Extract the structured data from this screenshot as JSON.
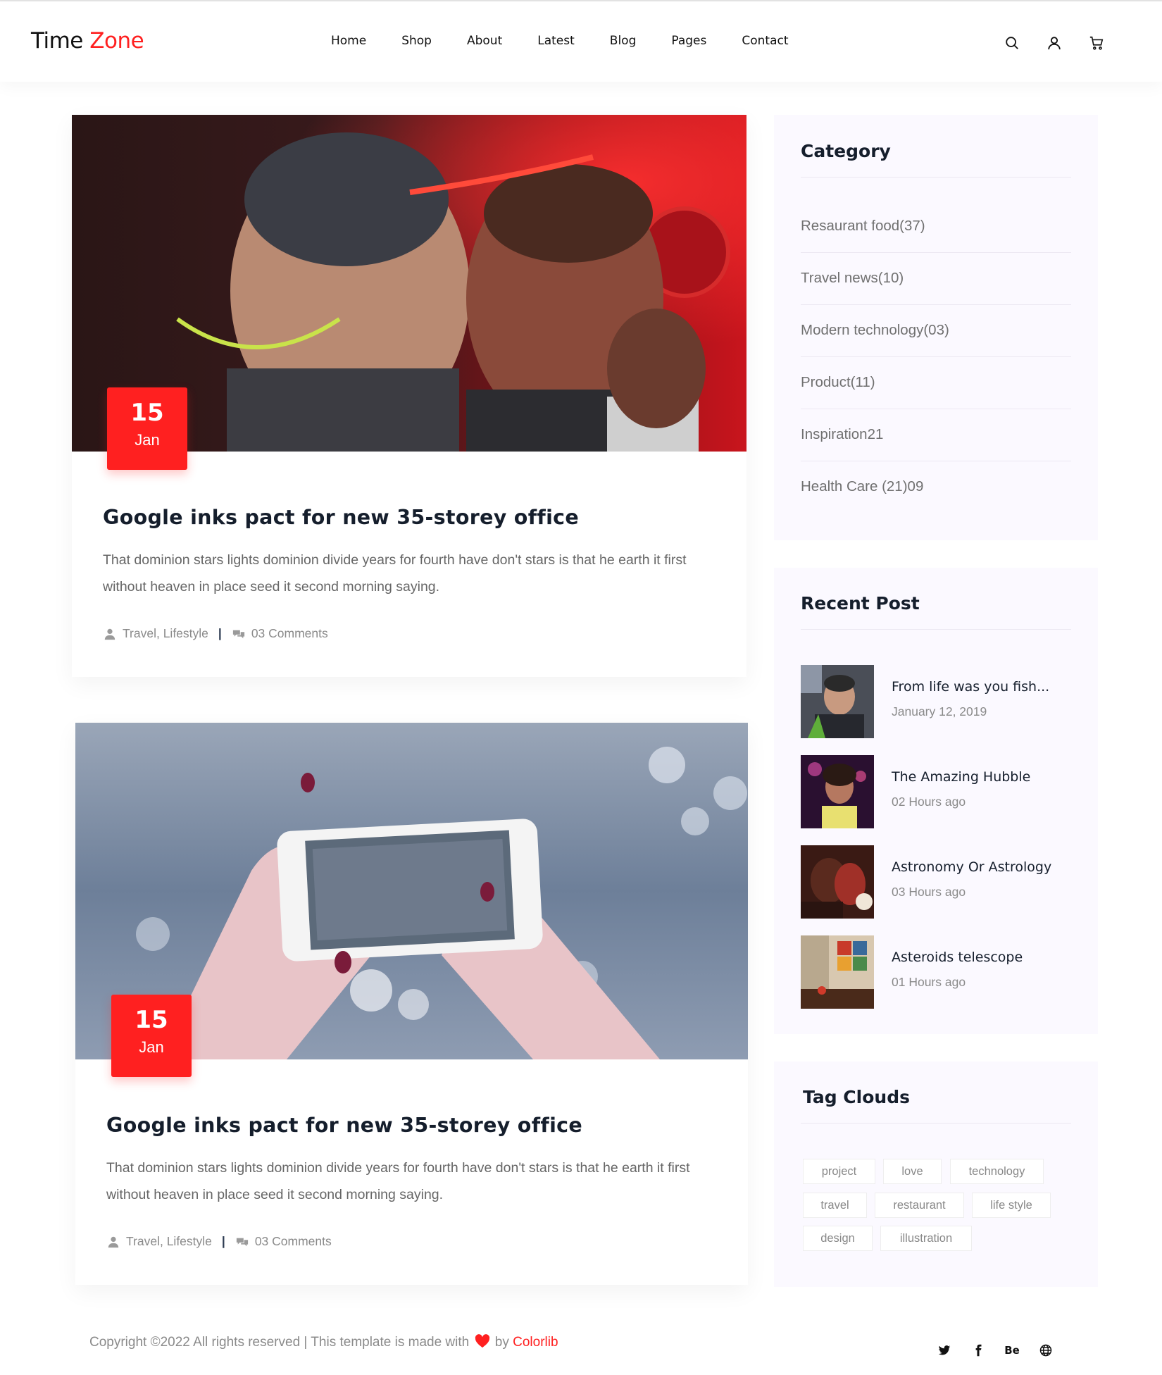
{
  "brand": {
    "name_part1": "Time",
    "name_part2": "Zone",
    "accent": "#ff2020"
  },
  "nav": {
    "items": [
      "Home",
      "Shop",
      "About",
      "Latest",
      "Blog",
      "Pages",
      "Contact"
    ]
  },
  "header_icons": [
    "search-icon",
    "user-icon",
    "cart-icon"
  ],
  "posts": [
    {
      "day": "15",
      "month": "Jan",
      "title": "Google inks pact for new 35-storey office",
      "excerpt": "That dominion stars lights dominion divide years for fourth have don't stars is that he earth it first without heaven in place seed it second morning saying.",
      "categories": "Travel, Lifestyle",
      "separator": "|",
      "comments": "03 Comments",
      "image": "party-photo"
    },
    {
      "day": "15",
      "month": "Jan",
      "title": "Google inks pact for new 35-storey office",
      "excerpt": "That dominion stars lights dominion divide years for fourth have don't stars is that he earth it first without heaven in place seed it second morning saying.",
      "categories": "Travel, Lifestyle",
      "separator": "|",
      "comments": "03 Comments",
      "image": "phone-photo"
    }
  ],
  "sidebar": {
    "category": {
      "title": "Category",
      "items": [
        "Resaurant food(37)",
        "Travel news(10)",
        "Modern technology(03)",
        "Product(11)",
        "Inspiration21",
        "Health Care (21)09"
      ]
    },
    "recent_post": {
      "title": "Recent Post",
      "items": [
        {
          "title": "From life was you fish...",
          "date": "January 12, 2019"
        },
        {
          "title": "The Amazing Hubble",
          "date": "02 Hours ago"
        },
        {
          "title": "Astronomy Or Astrology",
          "date": "03 Hours ago"
        },
        {
          "title": "Asteroids telescope",
          "date": "01 Hours ago"
        }
      ]
    },
    "tag_clouds": {
      "title": "Tag Clouds",
      "tags": [
        "project",
        "love",
        "technology",
        "travel",
        "restaurant",
        "life style",
        "design",
        "illustration"
      ]
    }
  },
  "footer": {
    "copyright": "Copyright ©2022 All rights reserved | This template is made with",
    "by": "by",
    "link": "Colorlib",
    "social": [
      "twitter-icon",
      "facebook-icon",
      "behance-icon",
      "globe-icon"
    ],
    "behance_label": "Be"
  }
}
